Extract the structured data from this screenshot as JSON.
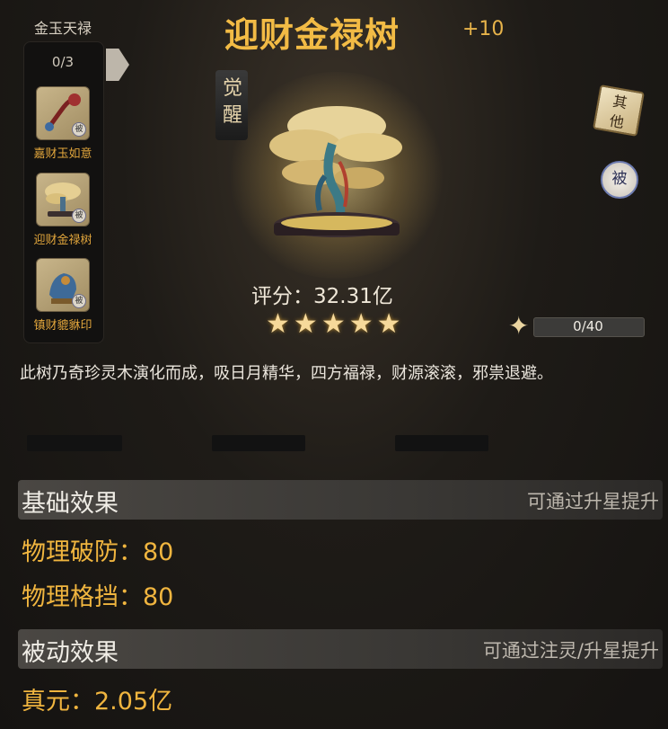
{
  "set": {
    "title": "金玉天禄",
    "count": "0/3",
    "items": [
      {
        "label": "嘉财玉如意",
        "tag": "被"
      },
      {
        "label": "迎财金禄树",
        "tag": "被"
      },
      {
        "label": "镇财貔貅印",
        "tag": "被"
      }
    ]
  },
  "header": {
    "title": "迎财金禄树",
    "level": "+10",
    "awaken_label": "觉醒"
  },
  "side_buttons": {
    "other": "其他",
    "passive": "被"
  },
  "rating": {
    "text": "评分：32.31亿",
    "stars": 5,
    "star_char": "★"
  },
  "fragments": {
    "text": "0/40",
    "progress": 0
  },
  "description": "此树乃奇珍灵木演化而成，吸日月精华，四方福禄，财源滚滚，邪祟退避。",
  "base_effects": {
    "title": "基础效果",
    "hint": "可通过升星提升",
    "stats": [
      "物理破防：80",
      "物理格挡：80"
    ]
  },
  "passive_effects": {
    "title": "被动效果",
    "hint": "可通过注灵/升星提升",
    "stats": [
      "真元：2.05亿"
    ]
  },
  "colors": {
    "title_gold": "#f2bb45",
    "stat_orange": "#f0b53f",
    "set_label": "#e2a63c"
  }
}
